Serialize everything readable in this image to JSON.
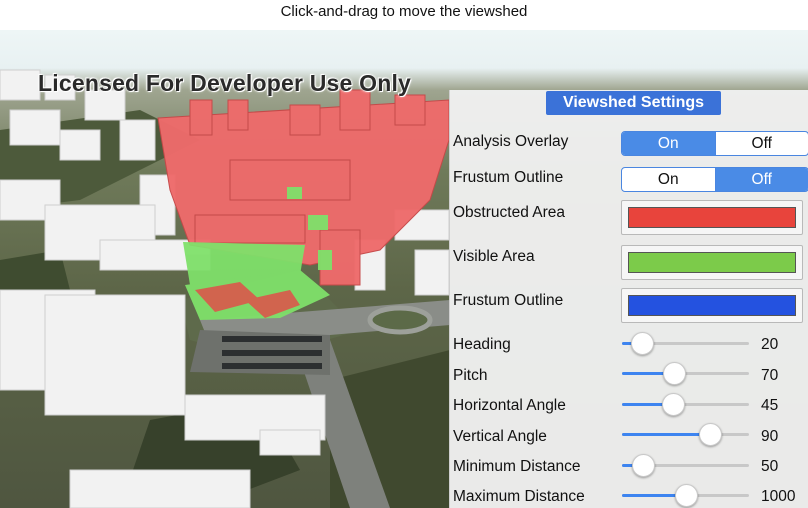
{
  "instruction": "Click-and-drag to move the viewshed",
  "watermark": "Licensed For Developer Use Only",
  "panel": {
    "title": "Viewshed Settings",
    "toggles": [
      {
        "label": "Analysis Overlay",
        "on": "On",
        "off": "Off",
        "selected": "On"
      },
      {
        "label": "Frustum Outline",
        "on": "On",
        "off": "Off",
        "selected": "Off"
      }
    ],
    "colors": [
      {
        "label": "Obstructed Area",
        "color": "#e8443c"
      },
      {
        "label": "Visible Area",
        "color": "#7ccb4a"
      },
      {
        "label": "Frustum Outline",
        "color": "#2452e0"
      }
    ],
    "sliders": [
      {
        "label": "Heading",
        "value": "20",
        "fraction": 0.11
      },
      {
        "label": "Pitch",
        "value": "70",
        "fraction": 0.4
      },
      {
        "label": "Horizontal Angle",
        "value": "45",
        "fraction": 0.39
      },
      {
        "label": "Vertical Angle",
        "value": "90",
        "fraction": 0.72
      },
      {
        "label": "Minimum Distance",
        "value": "50",
        "fraction": 0.12
      },
      {
        "label": "Maximum Distance",
        "value": "1000",
        "fraction": 0.5
      }
    ]
  }
}
